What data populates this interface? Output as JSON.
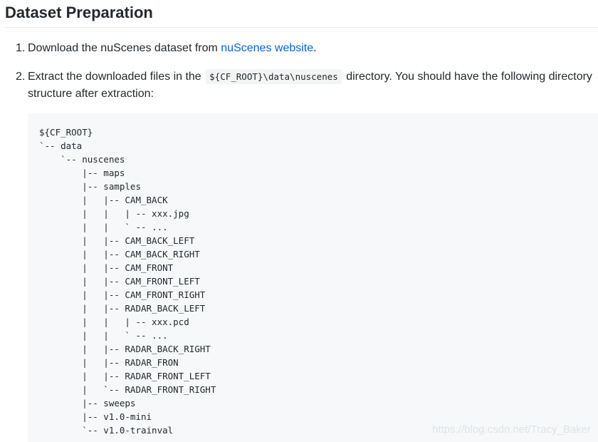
{
  "heading": "Dataset Preparation",
  "steps": [
    {
      "number": "1.",
      "text_before": "Download the nuScenes dataset from ",
      "link_text": "nuScenes website",
      "text_after": "."
    },
    {
      "number": "2.",
      "text_before": "Extract the downloaded files in the ",
      "code": "${CF_ROOT}\\data\\nuscenes",
      "text_after": " directory. You should have the following directory structure after extraction:"
    }
  ],
  "code_block": {
    "lines": [
      "${CF_ROOT}",
      "`-- data",
      "    `-- nuscenes",
      "        |-- maps",
      "        |-- samples",
      "        |   |-- CAM_BACK",
      "        |   |   | -- xxx.jpg",
      "        |   |   ` -- ...",
      "        |   |-- CAM_BACK_LEFT",
      "        |   |-- CAM_BACK_RIGHT",
      "        |   |-- CAM_FRONT",
      "        |   |-- CAM_FRONT_LEFT",
      "        |   |-- CAM_FRONT_RIGHT",
      "        |   |-- RADAR_BACK_LEFT",
      "        |   |   | -- xxx.pcd",
      "        |   |   ` -- ...",
      "        |   |-- RADAR_BACK_RIGHT",
      "        |   |-- RADAR_FRON",
      "        |   |-- RADAR_FRONT_LEFT",
      "        |   `-- RADAR_FRONT_RIGHT",
      "        |-- sweeps",
      "        |-- v1.0-mini",
      "        `-- v1.0-trainval"
    ]
  },
  "watermark": "https://blog.csdn.net/Tracy_Baker",
  "colors": {
    "link": "#0366d6",
    "text": "#24292e",
    "code_background": "#f6f8fa",
    "rule": "#eaecef"
  }
}
